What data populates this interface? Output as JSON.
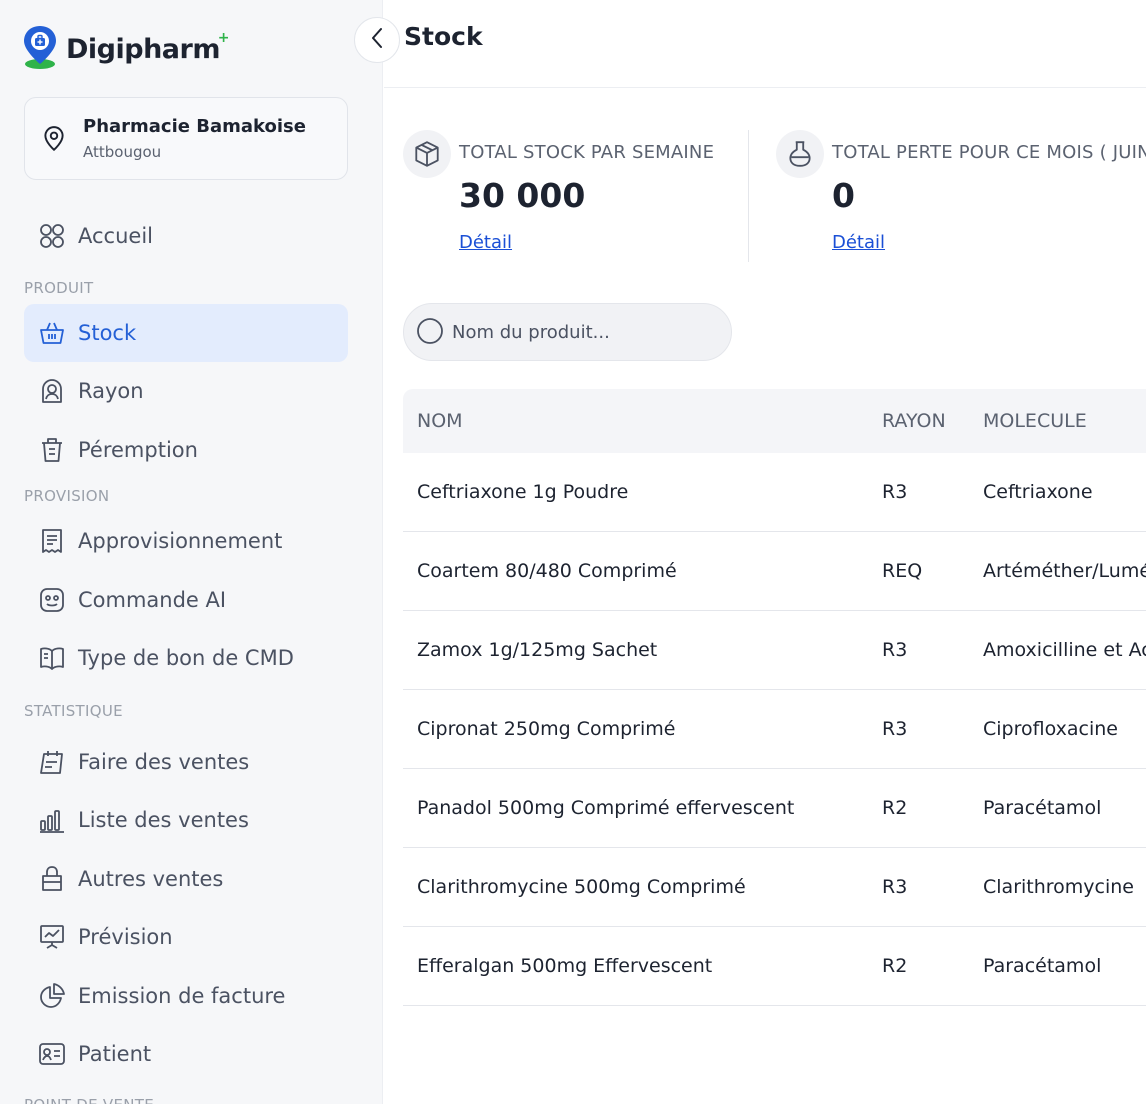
{
  "app": {
    "name": "Digipharm",
    "logo_plus": "+"
  },
  "pharmacy": {
    "name": "Pharmacie Bamakoise",
    "location": "Attbougou"
  },
  "sidebar": {
    "home": {
      "label": "Accueil",
      "icon": "grid-icon"
    },
    "sections": [
      {
        "label": "PRODUIT",
        "items": [
          {
            "label": "Stock",
            "icon": "basket-icon",
            "active": true
          },
          {
            "label": "Rayon",
            "icon": "shelf-icon"
          },
          {
            "label": "Péremption",
            "icon": "trash-icon"
          }
        ]
      },
      {
        "label": "PROVISION",
        "items": [
          {
            "label": "Approvisionnement",
            "icon": "receipt-icon"
          },
          {
            "label": "Commande AI",
            "icon": "robot-icon"
          },
          {
            "label": "Type de bon de CMD",
            "icon": "book-icon"
          }
        ]
      },
      {
        "label": "STATISTIQUE",
        "items": [
          {
            "label": "Faire des ventes",
            "icon": "calendar-edit-icon"
          },
          {
            "label": "Liste des ventes",
            "icon": "bar-chart-icon"
          },
          {
            "label": "Autres ventes",
            "icon": "bag-icon"
          },
          {
            "label": "Prévision",
            "icon": "presentation-icon"
          },
          {
            "label": "Emission de facture",
            "icon": "pie-chart-icon"
          },
          {
            "label": "Patient",
            "icon": "id-card-icon"
          }
        ]
      }
    ],
    "next_section_label": "POINT DE VENTE"
  },
  "header": {
    "title": "Stock"
  },
  "stats": [
    {
      "label": "TOTAL STOCK PAR SEMAINE",
      "value": "30 000",
      "link": "Détail",
      "icon": "box-icon"
    },
    {
      "label": "TOTAL PERTE POUR CE MOIS ( JUIN )",
      "value": "0",
      "link": "Détail",
      "icon": "flask-icon"
    }
  ],
  "search": {
    "placeholder": "Nom du produit..."
  },
  "table": {
    "columns": [
      "NOM",
      "RAYON",
      "MOLECULE"
    ],
    "rows": [
      [
        "Ceftriaxone 1g Poudre",
        "R3",
        "Ceftriaxone"
      ],
      [
        "Coartem 80/480 Comprimé",
        "REQ",
        "Artéméther/Luméfantrine"
      ],
      [
        "Zamox 1g/125mg Sachet",
        "R3",
        "Amoxicilline et Acide clavulanique"
      ],
      [
        "Cipronat 250mg Comprimé",
        "R3",
        "Ciprofloxacine"
      ],
      [
        "Panadol 500mg Comprimé effervescent",
        "R2",
        "Paracétamol"
      ],
      [
        "Clarithromycine 500mg Comprimé",
        "R3",
        "Clarithromycine"
      ],
      [
        "Efferalgan 500mg Effervescent",
        "R2",
        "Paracétamol"
      ]
    ]
  },
  "colors": {
    "accent": "#2460d6",
    "active_bg": "#e3ecfd",
    "link": "#1a4fd6",
    "logo_green": "#2fb34a"
  }
}
